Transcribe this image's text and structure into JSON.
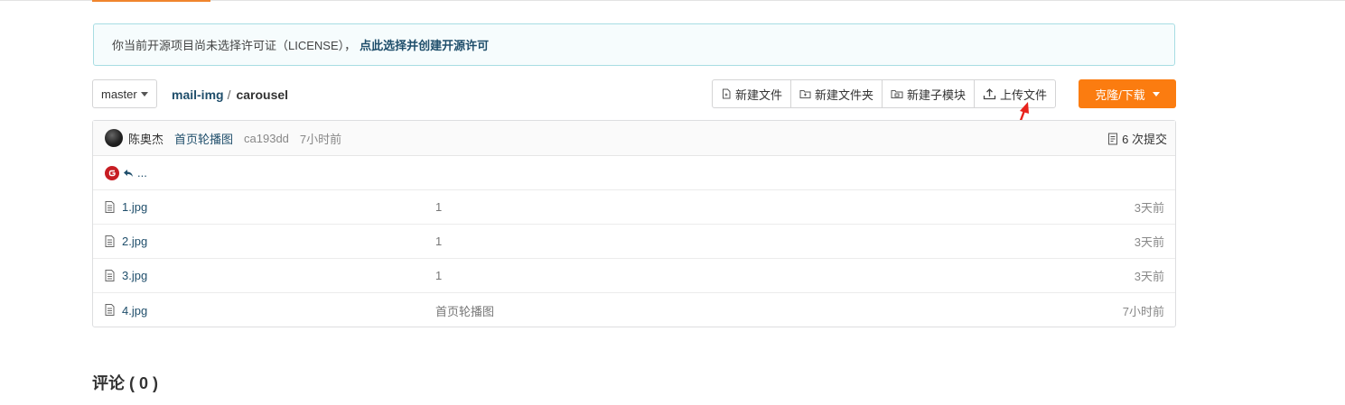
{
  "notice": {
    "text": "你当前开源项目尚未选择许可证（LICENSE），",
    "link": "点此选择并创建开源许可"
  },
  "branch": {
    "label": "master"
  },
  "breadcrumb": {
    "repo": "mail-img",
    "separator": "/",
    "current": "carousel"
  },
  "toolbar": {
    "new_file": "新建文件",
    "new_folder": "新建文件夹",
    "new_submodule": "新建子模块",
    "upload": "上传文件",
    "clone": "克隆/下载"
  },
  "commit": {
    "author": "陈奥杰",
    "message": "首页轮播图",
    "sha": "ca193dd",
    "time": "7小时前",
    "count": "6 次提交"
  },
  "back": {
    "label": "..."
  },
  "files": [
    {
      "name": "1.jpg",
      "message": "1",
      "time": "3天前"
    },
    {
      "name": "2.jpg",
      "message": "1",
      "time": "3天前"
    },
    {
      "name": "3.jpg",
      "message": "1",
      "time": "3天前"
    },
    {
      "name": "4.jpg",
      "message": "首页轮播图",
      "time": "7小时前"
    }
  ],
  "comments": {
    "title": "评论 ( 0 )"
  },
  "colors": {
    "accent": "#fb7c10",
    "link": "#1f4e6b",
    "annotation_arrow": "#e8231d"
  },
  "icons": [
    "file-add-icon",
    "folder-add-icon",
    "submodule-icon",
    "upload-icon",
    "commits-icon",
    "gitee-logo-icon",
    "back-arrow-icon",
    "file-icon",
    "red-arrow-icon"
  ]
}
